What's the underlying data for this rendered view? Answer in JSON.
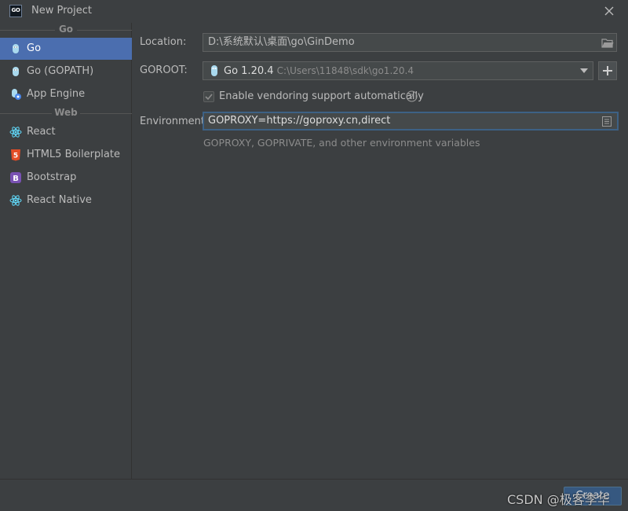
{
  "window": {
    "title": "New Project",
    "logo_text": "GO",
    "logo_icon": "goland-logo-icon",
    "close_icon": "close-icon"
  },
  "sidebar": {
    "groups": [
      {
        "label": "Go",
        "items": [
          {
            "label": "Go",
            "icon": "go-gopher-icon",
            "selected": true
          },
          {
            "label": "Go (GOPATH)",
            "icon": "go-gopher-icon",
            "selected": false
          },
          {
            "label": "App Engine",
            "icon": "app-engine-icon",
            "selected": false
          }
        ]
      },
      {
        "label": "Web",
        "items": [
          {
            "label": "React",
            "icon": "react-icon",
            "selected": false
          },
          {
            "label": "HTML5 Boilerplate",
            "icon": "html5-icon",
            "selected": false
          },
          {
            "label": "Bootstrap",
            "icon": "bootstrap-icon",
            "selected": false
          },
          {
            "label": "React Native",
            "icon": "react-icon",
            "selected": false
          }
        ]
      }
    ]
  },
  "form": {
    "location": {
      "label": "Location:",
      "value": "D:\\系统默认\\桌面\\go\\GinDemo",
      "icon": "folder-icon"
    },
    "goroot": {
      "label": "GOROOT:",
      "version": "Go 1.20.4",
      "path": "C:\\Users\\11848\\sdk\\go1.20.4",
      "add_icon": "plus-icon"
    },
    "vendoring": {
      "label": "Enable vendoring support automatically",
      "checked": true,
      "help_icon": "help-icon"
    },
    "environment": {
      "label": "Environment:",
      "value": "GOPROXY=https://goproxy.cn,direct",
      "hint": "GOPROXY, GOPRIVATE, and other environment variables",
      "icon": "edit-list-icon"
    }
  },
  "footer": {
    "create_label": "Create",
    "watermark": "CSDN @极客李华"
  },
  "colors": {
    "background": "#3c3f41",
    "selection": "#4b6eaf",
    "field": "#45494a",
    "focus_border": "#3d6185",
    "primary_button": "#365880"
  }
}
